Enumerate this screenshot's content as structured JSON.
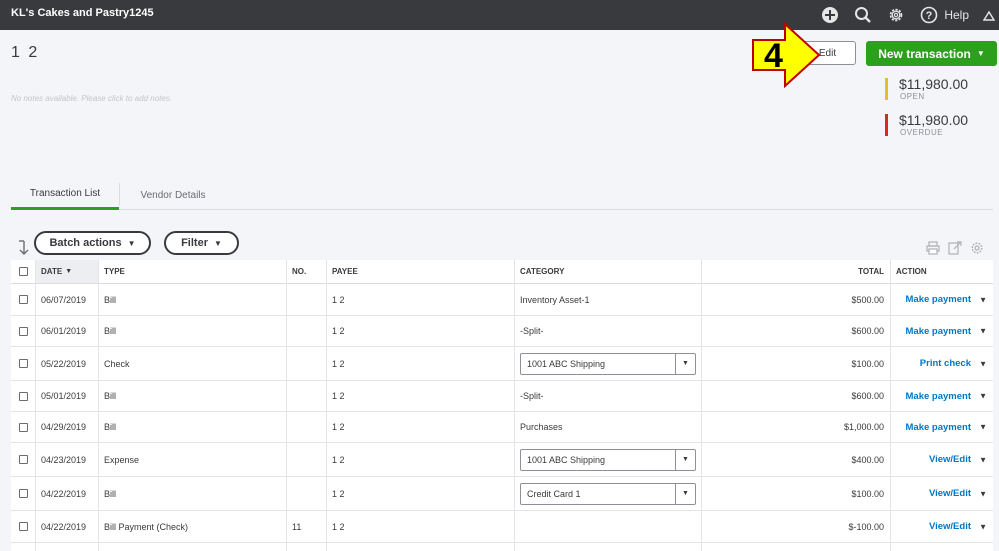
{
  "topbar": {
    "company": "KL's Cakes and Pastry1245",
    "help_label": "Help",
    "icons": [
      "plus-circle-icon",
      "search-icon",
      "gear-icon",
      "help-icon",
      "caret-up-icon"
    ]
  },
  "vendor": {
    "name": "1 2",
    "notes_placeholder": "No notes available. Please click to add notes."
  },
  "callout": {
    "number": "4",
    "color": "#ffff00"
  },
  "buttons": {
    "edit": "Edit",
    "new_transaction": "New transaction",
    "batch_actions": "Batch actions",
    "filter": "Filter"
  },
  "summary": {
    "open": {
      "amount": "$11,980.00",
      "label": "OPEN",
      "color": "#f2b635"
    },
    "overdue": {
      "amount": "$11,980.00",
      "label": "OVERDUE",
      "color": "#d52b1e"
    }
  },
  "tabs": [
    "Transaction List",
    "Vendor Details"
  ],
  "table": {
    "columns": {
      "date": "DATE",
      "type": "TYPE",
      "no": "NO.",
      "payee": "PAYEE",
      "category": "CATEGORY",
      "total": "TOTAL",
      "action": "ACTION"
    },
    "rows": [
      {
        "date": "06/07/2019",
        "type": "Bill",
        "no": "",
        "payee": "1 2",
        "category": "Inventory Asset-1",
        "category_select": false,
        "total": "$500.00",
        "action": "Make payment"
      },
      {
        "date": "06/01/2019",
        "type": "Bill",
        "no": "",
        "payee": "1 2",
        "category": "-Split-",
        "category_select": false,
        "total": "$600.00",
        "action": "Make payment"
      },
      {
        "date": "05/22/2019",
        "type": "Check",
        "no": "",
        "payee": "1 2",
        "category": "1001 ABC Shipping",
        "category_select": true,
        "total": "$100.00",
        "action": "Print check"
      },
      {
        "date": "05/01/2019",
        "type": "Bill",
        "no": "",
        "payee": "1 2",
        "category": "-Split-",
        "category_select": false,
        "total": "$600.00",
        "action": "Make payment"
      },
      {
        "date": "04/29/2019",
        "type": "Bill",
        "no": "",
        "payee": "1 2",
        "category": "Purchases",
        "category_select": false,
        "total": "$1,000.00",
        "action": "Make payment"
      },
      {
        "date": "04/23/2019",
        "type": "Expense",
        "no": "",
        "payee": "1 2",
        "category": "1001 ABC Shipping",
        "category_select": true,
        "total": "$400.00",
        "action": "View/Edit"
      },
      {
        "date": "04/22/2019",
        "type": "Bill",
        "no": "",
        "payee": "1 2",
        "category": "Credit Card 1",
        "category_select": true,
        "total": "$100.00",
        "action": "View/Edit"
      },
      {
        "date": "04/22/2019",
        "type": "Bill Payment (Check)",
        "no": "11",
        "payee": "1 2",
        "category": "",
        "category_select": false,
        "total": "$-100.00",
        "action": "View/Edit"
      }
    ]
  }
}
